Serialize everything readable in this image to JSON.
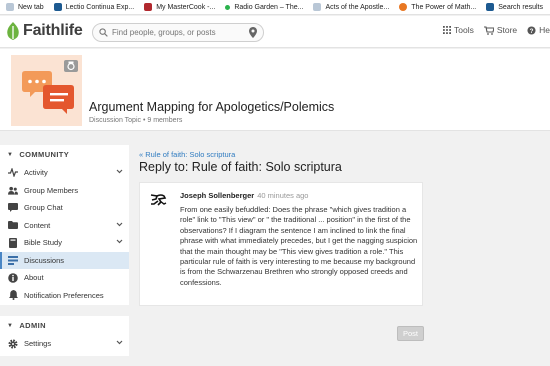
{
  "bookmarks": [
    {
      "label": "New tab",
      "icon": "page-icon",
      "color": "#b9c7d6"
    },
    {
      "label": "Lectio Continua Exp...",
      "icon": "bible-icon",
      "color": "#1d5a91"
    },
    {
      "label": "My MasterCook -...",
      "icon": "cook-icon",
      "color": "#b1282e"
    },
    {
      "label": "Radio Garden – The...",
      "icon": "dot-icon",
      "color": "#2bb24c"
    },
    {
      "label": "Acts of the Apostle...",
      "icon": "page-icon",
      "color": "#b9c7d6"
    },
    {
      "label": "The Power of Math...",
      "icon": "orange-icon",
      "color": "#e87722"
    },
    {
      "label": "Search results",
      "icon": "bible-icon",
      "color": "#1d5a91"
    }
  ],
  "header": {
    "logo_text": "Faithlife",
    "brand_color": "#6cb33f",
    "search_placeholder": "Find people, groups, or posts",
    "tools_label": "Tools",
    "store_label": "Store",
    "help_label": "Help"
  },
  "group": {
    "title": "Argument Mapping for Apologetics/Polemics",
    "type": "Discussion Topic",
    "members": "9 members"
  },
  "sidebar": {
    "community_label": "COMMUNITY",
    "items": [
      {
        "label": "Activity",
        "icon": "activity-icon"
      },
      {
        "label": "Group Members",
        "icon": "members-icon"
      },
      {
        "label": "Group Chat",
        "icon": "chat-icon"
      },
      {
        "label": "Content",
        "icon": "folder-icon"
      },
      {
        "label": "Bible Study",
        "icon": "book-icon"
      },
      {
        "label": "Discussions",
        "icon": "discussions-icon"
      },
      {
        "label": "About",
        "icon": "info-icon"
      },
      {
        "label": "Notification Preferences",
        "icon": "bell-icon"
      }
    ],
    "admin_label": "ADMIN",
    "settings_label": "Settings"
  },
  "main": {
    "breadcrumb": "« Rule of faith: Solo scriptura",
    "title": "Reply to: Rule of faith: Solo scriptura",
    "post": {
      "author": "Joseph Sollenberger",
      "time": "40 minutes ago",
      "body": "From one easily befuddled: Does the phrase \"which gives tradition a role\" link to \"This view\" or \" the traditional ... position\" in the first of the observations? If I diagram the sentence I am inclined to link the final phrase with what immediately precedes, but I get the nagging suspicion that the main thought may be \"This view gives tradition a role.\" This particular rule of faith is very interesting to me because my background is from the Schwarzenau Brethren who strongly opposed creeds and confessions."
    },
    "post_button": "Post"
  }
}
